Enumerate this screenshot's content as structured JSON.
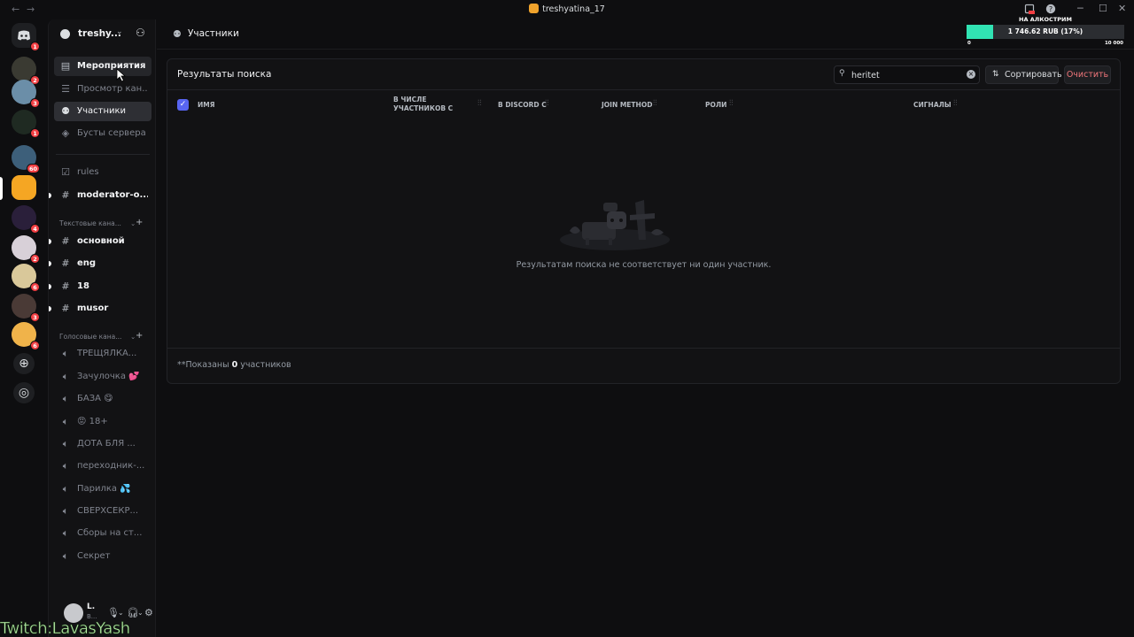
{
  "window": {
    "title": "treshyatina_17",
    "back": "←",
    "forward": "→"
  },
  "overlay": {
    "label": "НА АЛКОСТРИМ",
    "amount": "1 746.62 RUB (17%)",
    "min": "0",
    "max": "10 000",
    "progress": 0.17,
    "accent": "#31e3b3"
  },
  "rail": {
    "servers": [
      {
        "badge": "1",
        "color": "#5865f2",
        "icon": "discord-logo-icon"
      },
      {
        "badge": "2",
        "color": "#3a3a32"
      },
      {
        "badge": "3",
        "color": "#6b8ea8"
      },
      {
        "badge": "1",
        "color": "#1f2a22"
      },
      {
        "badge": "60",
        "color": "#3d5f7a"
      },
      {
        "badge": "",
        "color": "#f5a623"
      },
      {
        "badge": "4",
        "color": "#2a1f3a"
      },
      {
        "badge": "2",
        "color": "#d8d0d8"
      },
      {
        "badge": "6",
        "color": "#d9c89a"
      },
      {
        "badge": "3",
        "color": "#4a3a36"
      },
      {
        "badge": "6",
        "color": "#f0b34a"
      }
    ]
  },
  "guild": {
    "name": "treshy...",
    "items": [
      {
        "label": "Мероприятия",
        "icon": "calendar-icon"
      },
      {
        "label": "Просмотр кан...",
        "icon": "browse-channels-icon"
      },
      {
        "label": "Участники",
        "icon": "members-icon"
      },
      {
        "label": "Бусты сервера",
        "icon": "boost-icon"
      }
    ],
    "channels_top": [
      {
        "label": "rules",
        "icon": "rules-icon"
      },
      {
        "label": "moderator-o...",
        "icon": "hash-icon"
      }
    ],
    "text_category": "Текстовые кана...",
    "text_channels": [
      {
        "label": "основной"
      },
      {
        "label": "eng"
      },
      {
        "label": "18"
      },
      {
        "label": "musor"
      }
    ],
    "voice_category": "Голосовые кана...",
    "voice_channels": [
      {
        "label": "ТРЕЩЯЛКА..."
      },
      {
        "label": "Зачулочка 💕"
      },
      {
        "label": "БАЗА 😋"
      },
      {
        "label": "😡 18+"
      },
      {
        "label": "ДОТА БЛЯ ..."
      },
      {
        "label": "переходник-..."
      },
      {
        "label": "Парилка 💦"
      },
      {
        "label": "СВЕРХСЕКР..."
      },
      {
        "label": "Сборы на ст..."
      },
      {
        "label": "Секрет"
      }
    ]
  },
  "user": {
    "name": "L.",
    "status": "B..."
  },
  "watermark": "Twitch:LavasYash",
  "header": {
    "title": "Участники"
  },
  "panel": {
    "title": "Результаты поиска",
    "search_value": "heritet",
    "sort_label": "Сортировать",
    "clear_label": "Очистить",
    "columns": {
      "name": "ИМЯ",
      "member_since": "В ЧИСЛЕ УЧАСТНИКОВ С",
      "discord_since": "В DISCORD С",
      "join_method": "JOIN METHOD",
      "roles": "РОЛИ",
      "signals": "СИГНАЛЫ"
    },
    "empty_text": "Результатам поиска не соответствует ни один участник.",
    "footer_prefix": "**Показаны",
    "footer_count": "0",
    "footer_suffix": "участников"
  }
}
